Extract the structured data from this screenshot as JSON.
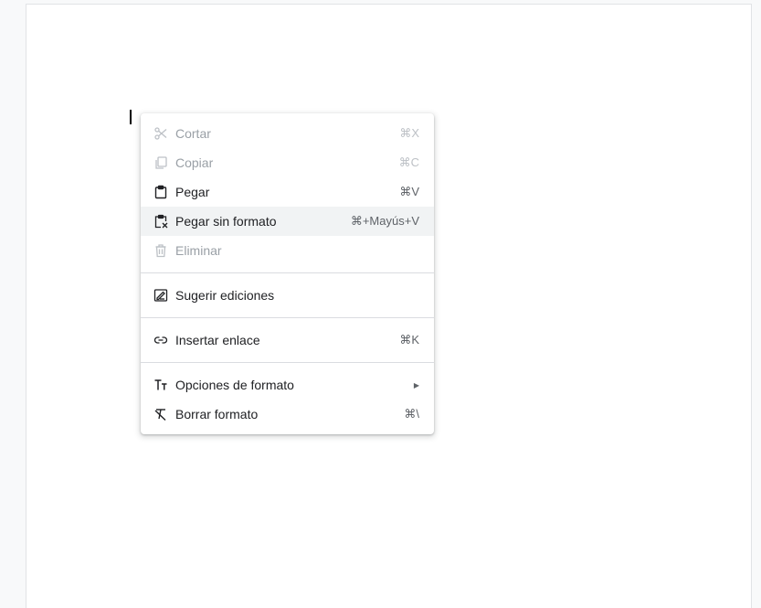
{
  "context_menu": {
    "items": [
      {
        "label": "Cortar",
        "shortcut": "⌘X",
        "icon": "scissors-icon",
        "disabled": true
      },
      {
        "label": "Copiar",
        "shortcut": "⌘C",
        "icon": "copy-icon",
        "disabled": true
      },
      {
        "label": "Pegar",
        "shortcut": "⌘V",
        "icon": "clipboard-icon",
        "disabled": false
      },
      {
        "label": "Pegar sin formato",
        "shortcut": "⌘+Mayús+V",
        "icon": "paste-plain-icon",
        "disabled": false,
        "hovered": true
      },
      {
        "label": "Eliminar",
        "shortcut": "",
        "icon": "trash-icon",
        "disabled": true
      },
      {
        "label": "Sugerir ediciones",
        "shortcut": "",
        "icon": "suggest-edit-icon",
        "disabled": false
      },
      {
        "label": "Insertar enlace",
        "shortcut": "⌘K",
        "icon": "link-icon",
        "disabled": false
      },
      {
        "label": "Opciones de formato",
        "shortcut": "",
        "icon": "text-format-icon",
        "disabled": false,
        "submenu": true
      },
      {
        "label": "Borrar formato",
        "shortcut": "⌘\\",
        "icon": "clear-format-icon",
        "disabled": false
      }
    ]
  },
  "colors": {
    "text": "#202124",
    "disabled_text": "#9aa0a6",
    "hover_bg": "#f1f3f4",
    "separator": "#dadce0",
    "canvas_bg": "#f8f9fa"
  }
}
